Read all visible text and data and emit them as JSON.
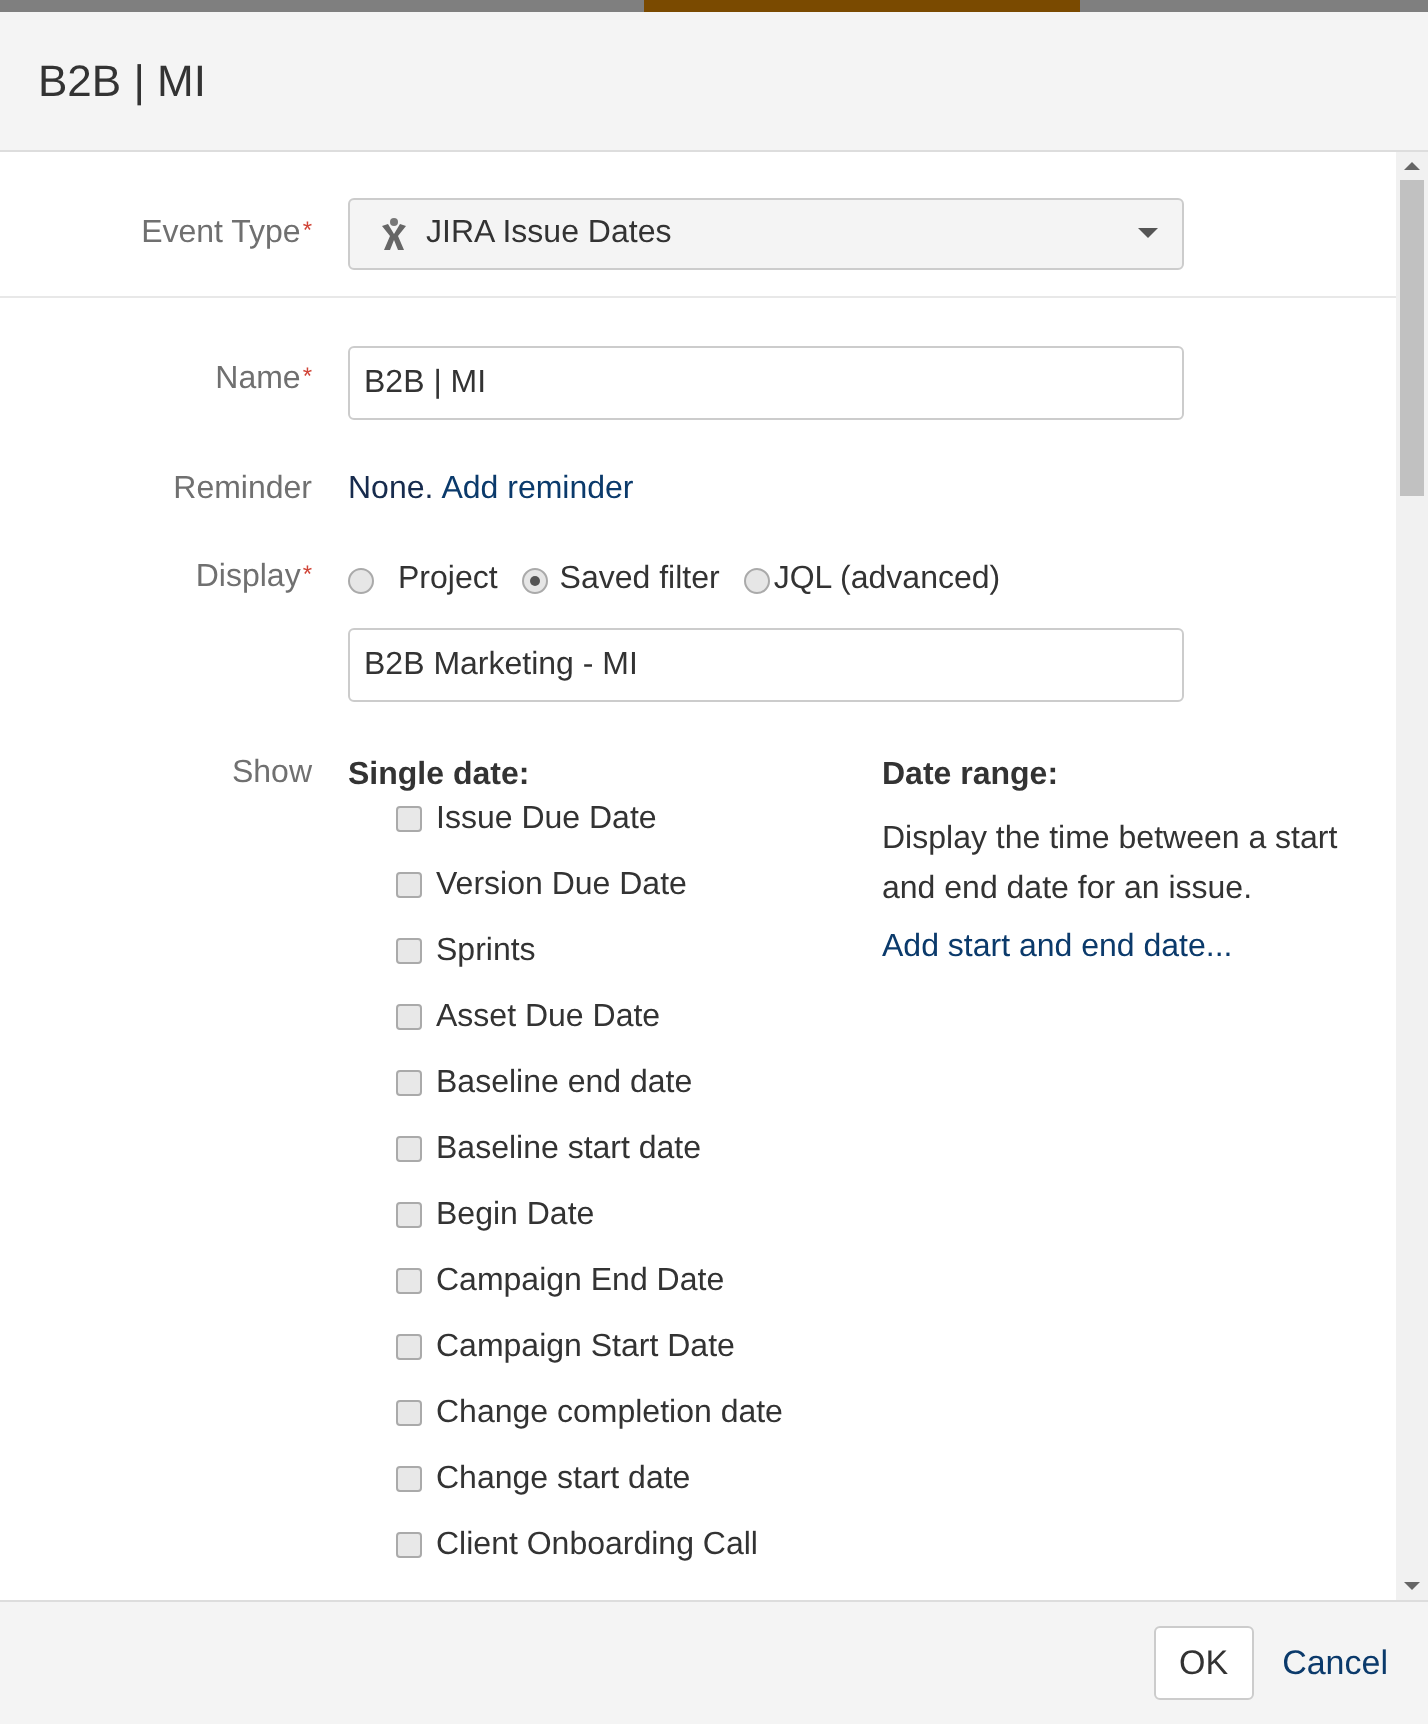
{
  "dialog": {
    "title": "B2B | MI"
  },
  "event_type": {
    "label": "Event Type",
    "required_mark": "*",
    "value": "JIRA Issue Dates"
  },
  "name": {
    "label": "Name",
    "required_mark": "*",
    "value": "B2B | MI"
  },
  "reminder": {
    "label": "Reminder",
    "text": "None.",
    "link": "Add reminder"
  },
  "display": {
    "label": "Display",
    "required_mark": "*",
    "options": [
      {
        "label": "Project",
        "selected": false
      },
      {
        "label": "Saved filter",
        "selected": true
      },
      {
        "label": "JQL (advanced)",
        "selected": false
      }
    ],
    "filter_value": "B2B Marketing - MI"
  },
  "show": {
    "label": "Show",
    "single_date": {
      "heading": "Single date:",
      "options": [
        {
          "label": "Issue Due Date",
          "checked": false
        },
        {
          "label": "Version Due Date",
          "checked": false
        },
        {
          "label": "Sprints",
          "checked": false
        },
        {
          "label": "Asset Due Date",
          "checked": false
        },
        {
          "label": "Baseline end date",
          "checked": false
        },
        {
          "label": "Baseline start date",
          "checked": false
        },
        {
          "label": "Begin Date",
          "checked": false
        },
        {
          "label": "Campaign End Date",
          "checked": false
        },
        {
          "label": "Campaign Start Date",
          "checked": false
        },
        {
          "label": "Change completion date",
          "checked": false
        },
        {
          "label": "Change start date",
          "checked": false
        },
        {
          "label": "Client Onboarding Call",
          "checked": false
        }
      ]
    },
    "date_range": {
      "heading": "Date range:",
      "description": "Display the time between a start and end date for an issue.",
      "link": "Add start and end date..."
    }
  },
  "buttons": {
    "ok": "OK",
    "cancel": "Cancel"
  }
}
